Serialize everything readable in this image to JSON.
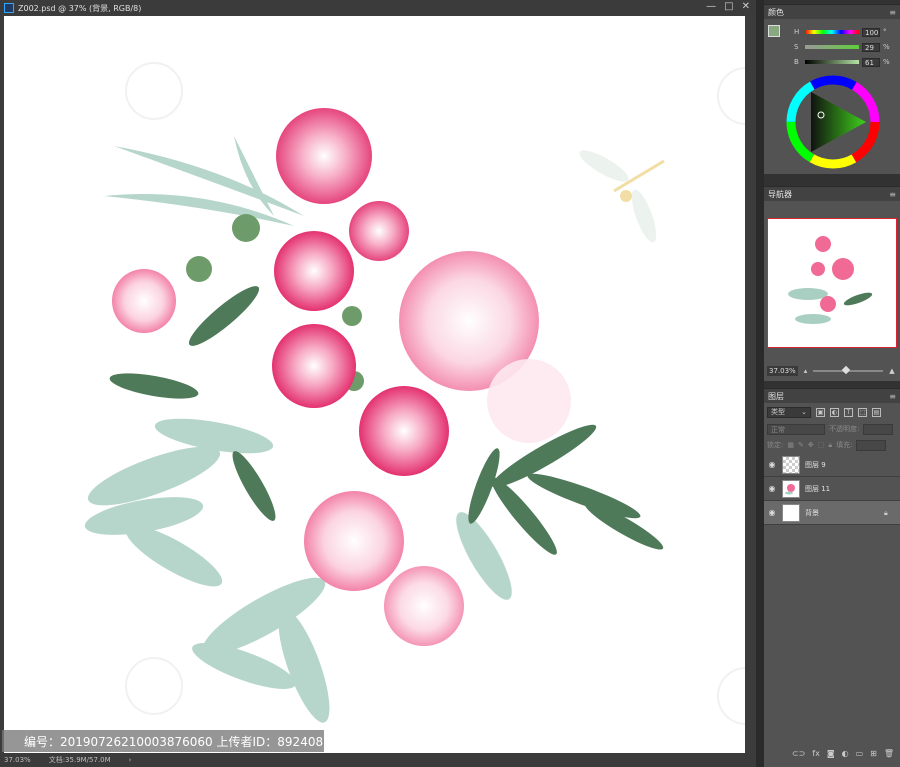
{
  "document": {
    "title": "Z002.psd @ 37% (背景, RGB/8)",
    "zoom_status": "37.03%",
    "file_info": "文档:35.9M/57.0M",
    "window_controls": [
      "—",
      "□",
      "✕"
    ]
  },
  "watermark": {
    "caption": "编号：20190726210003876060 上传者ID：892408"
  },
  "color_panel": {
    "title": "颜色",
    "foreground": "#8aa880",
    "background": "#ffffff",
    "rows": [
      {
        "label": "H",
        "value": "100",
        "unit": "°"
      },
      {
        "label": "S",
        "value": "29",
        "unit": "%"
      },
      {
        "label": "B",
        "value": "61",
        "unit": "%"
      }
    ]
  },
  "navigator_panel": {
    "title": "导航器",
    "zoom": "37.03%"
  },
  "layers_panel": {
    "title": "图层",
    "kind_label": "类型",
    "blend_mode": "正常",
    "opacity_label": "不透明度:",
    "lock_label": "锁定:",
    "fill_label": "填充:",
    "layers": [
      {
        "name": "图层 9",
        "thumb": "transparent",
        "active": false
      },
      {
        "name": "图层 11",
        "thumb": "flowers",
        "active": false
      },
      {
        "name": "背景",
        "thumb": "white",
        "active": true,
        "locked": true
      }
    ]
  },
  "colors": {
    "accent_green": "#8aa880",
    "flower_pink": "#f06a95",
    "leaf_dark": "#4f7a5a",
    "leaf_light": "#a9cfc2"
  }
}
